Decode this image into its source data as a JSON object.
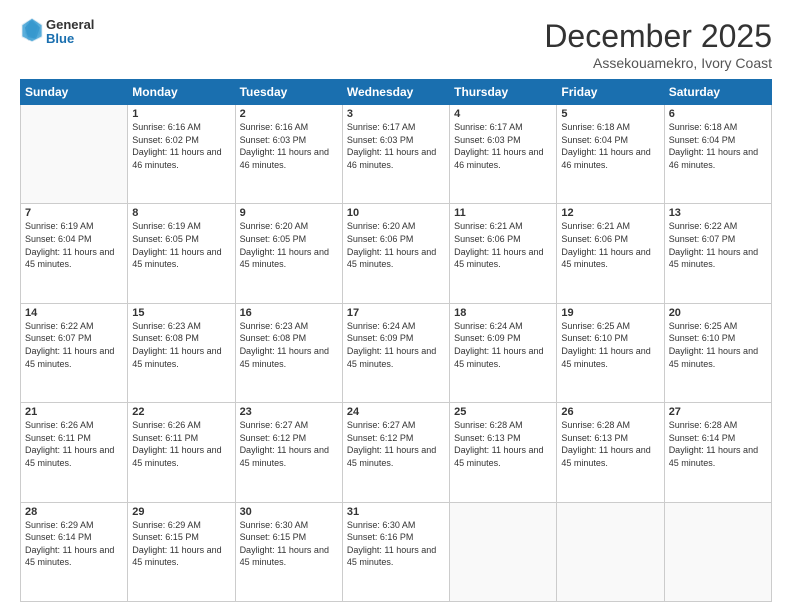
{
  "header": {
    "logo": {
      "general": "General",
      "blue": "Blue"
    },
    "title": "December 2025",
    "subtitle": "Assekouamekro, Ivory Coast"
  },
  "calendar": {
    "headers": [
      "Sunday",
      "Monday",
      "Tuesday",
      "Wednesday",
      "Thursday",
      "Friday",
      "Saturday"
    ],
    "rows": [
      [
        {
          "day": null,
          "sunrise": null,
          "sunset": null,
          "daylight": null
        },
        {
          "day": "1",
          "sunrise": "6:16 AM",
          "sunset": "6:02 PM",
          "daylight": "11 hours and 46 minutes."
        },
        {
          "day": "2",
          "sunrise": "6:16 AM",
          "sunset": "6:03 PM",
          "daylight": "11 hours and 46 minutes."
        },
        {
          "day": "3",
          "sunrise": "6:17 AM",
          "sunset": "6:03 PM",
          "daylight": "11 hours and 46 minutes."
        },
        {
          "day": "4",
          "sunrise": "6:17 AM",
          "sunset": "6:03 PM",
          "daylight": "11 hours and 46 minutes."
        },
        {
          "day": "5",
          "sunrise": "6:18 AM",
          "sunset": "6:04 PM",
          "daylight": "11 hours and 46 minutes."
        },
        {
          "day": "6",
          "sunrise": "6:18 AM",
          "sunset": "6:04 PM",
          "daylight": "11 hours and 46 minutes."
        }
      ],
      [
        {
          "day": "7",
          "sunrise": "6:19 AM",
          "sunset": "6:04 PM",
          "daylight": "11 hours and 45 minutes."
        },
        {
          "day": "8",
          "sunrise": "6:19 AM",
          "sunset": "6:05 PM",
          "daylight": "11 hours and 45 minutes."
        },
        {
          "day": "9",
          "sunrise": "6:20 AM",
          "sunset": "6:05 PM",
          "daylight": "11 hours and 45 minutes."
        },
        {
          "day": "10",
          "sunrise": "6:20 AM",
          "sunset": "6:06 PM",
          "daylight": "11 hours and 45 minutes."
        },
        {
          "day": "11",
          "sunrise": "6:21 AM",
          "sunset": "6:06 PM",
          "daylight": "11 hours and 45 minutes."
        },
        {
          "day": "12",
          "sunrise": "6:21 AM",
          "sunset": "6:06 PM",
          "daylight": "11 hours and 45 minutes."
        },
        {
          "day": "13",
          "sunrise": "6:22 AM",
          "sunset": "6:07 PM",
          "daylight": "11 hours and 45 minutes."
        }
      ],
      [
        {
          "day": "14",
          "sunrise": "6:22 AM",
          "sunset": "6:07 PM",
          "daylight": "11 hours and 45 minutes."
        },
        {
          "day": "15",
          "sunrise": "6:23 AM",
          "sunset": "6:08 PM",
          "daylight": "11 hours and 45 minutes."
        },
        {
          "day": "16",
          "sunrise": "6:23 AM",
          "sunset": "6:08 PM",
          "daylight": "11 hours and 45 minutes."
        },
        {
          "day": "17",
          "sunrise": "6:24 AM",
          "sunset": "6:09 PM",
          "daylight": "11 hours and 45 minutes."
        },
        {
          "day": "18",
          "sunrise": "6:24 AM",
          "sunset": "6:09 PM",
          "daylight": "11 hours and 45 minutes."
        },
        {
          "day": "19",
          "sunrise": "6:25 AM",
          "sunset": "6:10 PM",
          "daylight": "11 hours and 45 minutes."
        },
        {
          "day": "20",
          "sunrise": "6:25 AM",
          "sunset": "6:10 PM",
          "daylight": "11 hours and 45 minutes."
        }
      ],
      [
        {
          "day": "21",
          "sunrise": "6:26 AM",
          "sunset": "6:11 PM",
          "daylight": "11 hours and 45 minutes."
        },
        {
          "day": "22",
          "sunrise": "6:26 AM",
          "sunset": "6:11 PM",
          "daylight": "11 hours and 45 minutes."
        },
        {
          "day": "23",
          "sunrise": "6:27 AM",
          "sunset": "6:12 PM",
          "daylight": "11 hours and 45 minutes."
        },
        {
          "day": "24",
          "sunrise": "6:27 AM",
          "sunset": "6:12 PM",
          "daylight": "11 hours and 45 minutes."
        },
        {
          "day": "25",
          "sunrise": "6:28 AM",
          "sunset": "6:13 PM",
          "daylight": "11 hours and 45 minutes."
        },
        {
          "day": "26",
          "sunrise": "6:28 AM",
          "sunset": "6:13 PM",
          "daylight": "11 hours and 45 minutes."
        },
        {
          "day": "27",
          "sunrise": "6:28 AM",
          "sunset": "6:14 PM",
          "daylight": "11 hours and 45 minutes."
        }
      ],
      [
        {
          "day": "28",
          "sunrise": "6:29 AM",
          "sunset": "6:14 PM",
          "daylight": "11 hours and 45 minutes."
        },
        {
          "day": "29",
          "sunrise": "6:29 AM",
          "sunset": "6:15 PM",
          "daylight": "11 hours and 45 minutes."
        },
        {
          "day": "30",
          "sunrise": "6:30 AM",
          "sunset": "6:15 PM",
          "daylight": "11 hours and 45 minutes."
        },
        {
          "day": "31",
          "sunrise": "6:30 AM",
          "sunset": "6:16 PM",
          "daylight": "11 hours and 45 minutes."
        },
        {
          "day": null,
          "sunrise": null,
          "sunset": null,
          "daylight": null
        },
        {
          "day": null,
          "sunrise": null,
          "sunset": null,
          "daylight": null
        },
        {
          "day": null,
          "sunrise": null,
          "sunset": null,
          "daylight": null
        }
      ]
    ]
  }
}
